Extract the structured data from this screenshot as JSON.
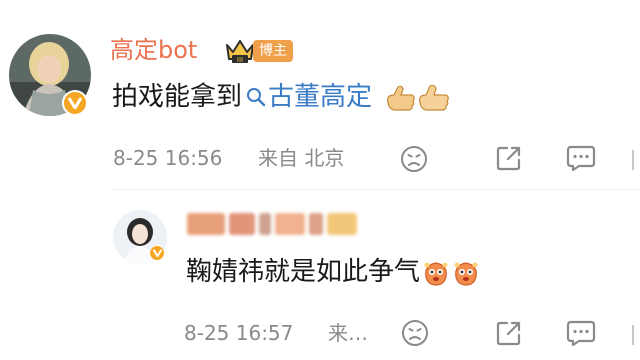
{
  "main_comment": {
    "username": "高定bot",
    "badge_label": "博主",
    "crown_level": "III",
    "text_prefix": "拍戏能拿到",
    "topic_link": "古董高定",
    "time": "8-25 16:56",
    "location": "来自 北京",
    "icons": [
      "dislike-face-icon",
      "share-icon",
      "comment-icon"
    ]
  },
  "reply": {
    "text": "鞠婧祎就是如此争气",
    "time": "8-25 16:57",
    "location_truncated": "来…",
    "icons": [
      "dislike-face-icon",
      "share-icon",
      "comment-icon"
    ]
  },
  "colors": {
    "username": "#eb7350",
    "link": "#3a7cc6",
    "meta": "#8a8a8a",
    "badge": "#f0a04b",
    "verified": "#f5a623"
  }
}
